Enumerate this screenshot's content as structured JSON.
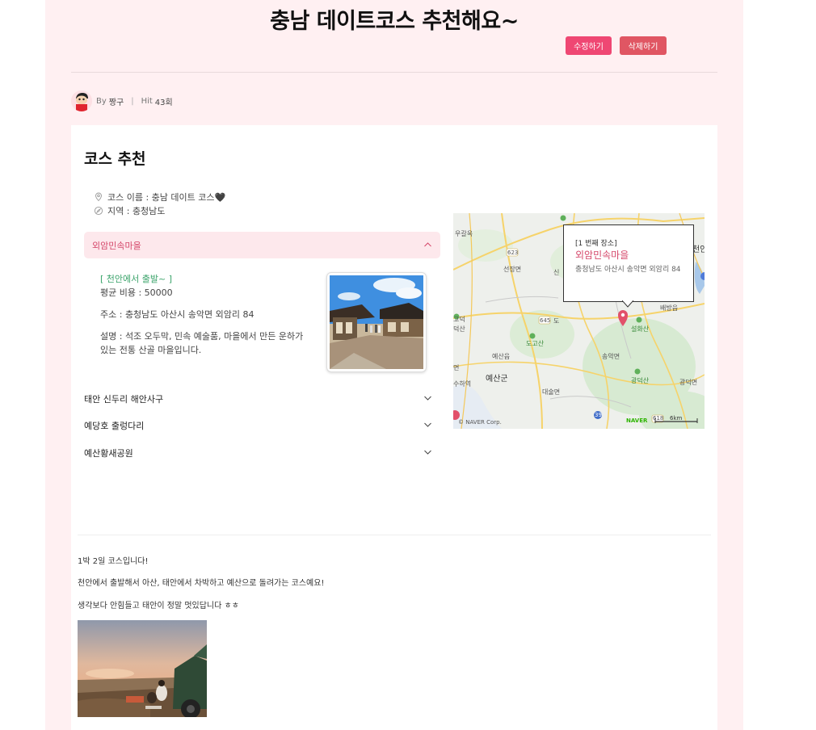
{
  "post": {
    "title": "충남 데이트코스 추천해요~",
    "edit_label": "수정하기",
    "delete_label": "삭제하기",
    "by_label": "By",
    "author": "짱구",
    "separator": "|",
    "hit_label": "Hit",
    "hit_count": "43회"
  },
  "course": {
    "heading": "코스 추천",
    "name_text": "코스 이름 : 충남 데이트 코스🖤",
    "region_text": "지역 : 충청남도",
    "icons": [
      "location-pin-icon",
      "compass-icon",
      "chevron-up-icon",
      "chevron-down-icon"
    ],
    "places": [
      {
        "title": "외암민속마을",
        "expanded": true,
        "subtitle": "[ 천안에서 출발~ ]",
        "cost": "평균 비용 : 50000",
        "address": "주소 : 충청남도 아산시 송악면 외암리 84",
        "description": "설명 : 석조 오두막, 민속 예술품, 마을에서 만든 운하가 있는 전통 산골 마을입니다."
      },
      {
        "title": "태안 신두리 해안사구",
        "expanded": false
      },
      {
        "title": "예당호 출렁다리",
        "expanded": false
      },
      {
        "title": "예산황새공원",
        "expanded": false
      }
    ]
  },
  "map": {
    "popup_order": "[1 번째 장소]",
    "popup_name": "외암민속마을",
    "popup_address": "충청남도 아산시 송악면 외암리 84",
    "labels": {
      "ugaok": "우갈옥",
      "seonjang": "선장면",
      "sin": "신",
      "cheonan": "천안",
      "baebang": "배방읍",
      "do": "도",
      "dogosan": "도고산",
      "seolhwasan": "설화산",
      "yesanmyeon": "예산읍",
      "songakmyeon": "송악면",
      "yesangun": "예산군",
      "myeon": "면",
      "suha": "수하역",
      "gwangdeok": "광덕면",
      "gwangdeoksan": "광덕산",
      "daesul": "대술면",
      "deoksan": "덕산",
      "gogo": "고덕",
      "road623": "623",
      "road645": "645",
      "road618": "618",
      "road39": "39",
      "naver_corp": "© NAVER Corp.",
      "naver": "NAVER",
      "scale": "6km"
    },
    "colors": {
      "land": "#eef0ec",
      "green": "#cfe6c9",
      "road": "#f6d36a",
      "water": "#a8c8ea",
      "pin": "#e2506a"
    }
  },
  "content": {
    "line1": "1박 2일 코스입니다!",
    "line2": "천안에서 출발해서 아산, 태안에서 차박하고 예산으로 돌려가는 코스예요!",
    "line3": "생각보다 안힘들고 태안이 정말 멋있답니다 ㅎㅎ"
  },
  "colors": {
    "page_bg": "#fff0f2",
    "accent": "#ef4773",
    "delete": "#e05663",
    "active_bg": "#fde8ec",
    "green_text": "#3aa36a"
  }
}
